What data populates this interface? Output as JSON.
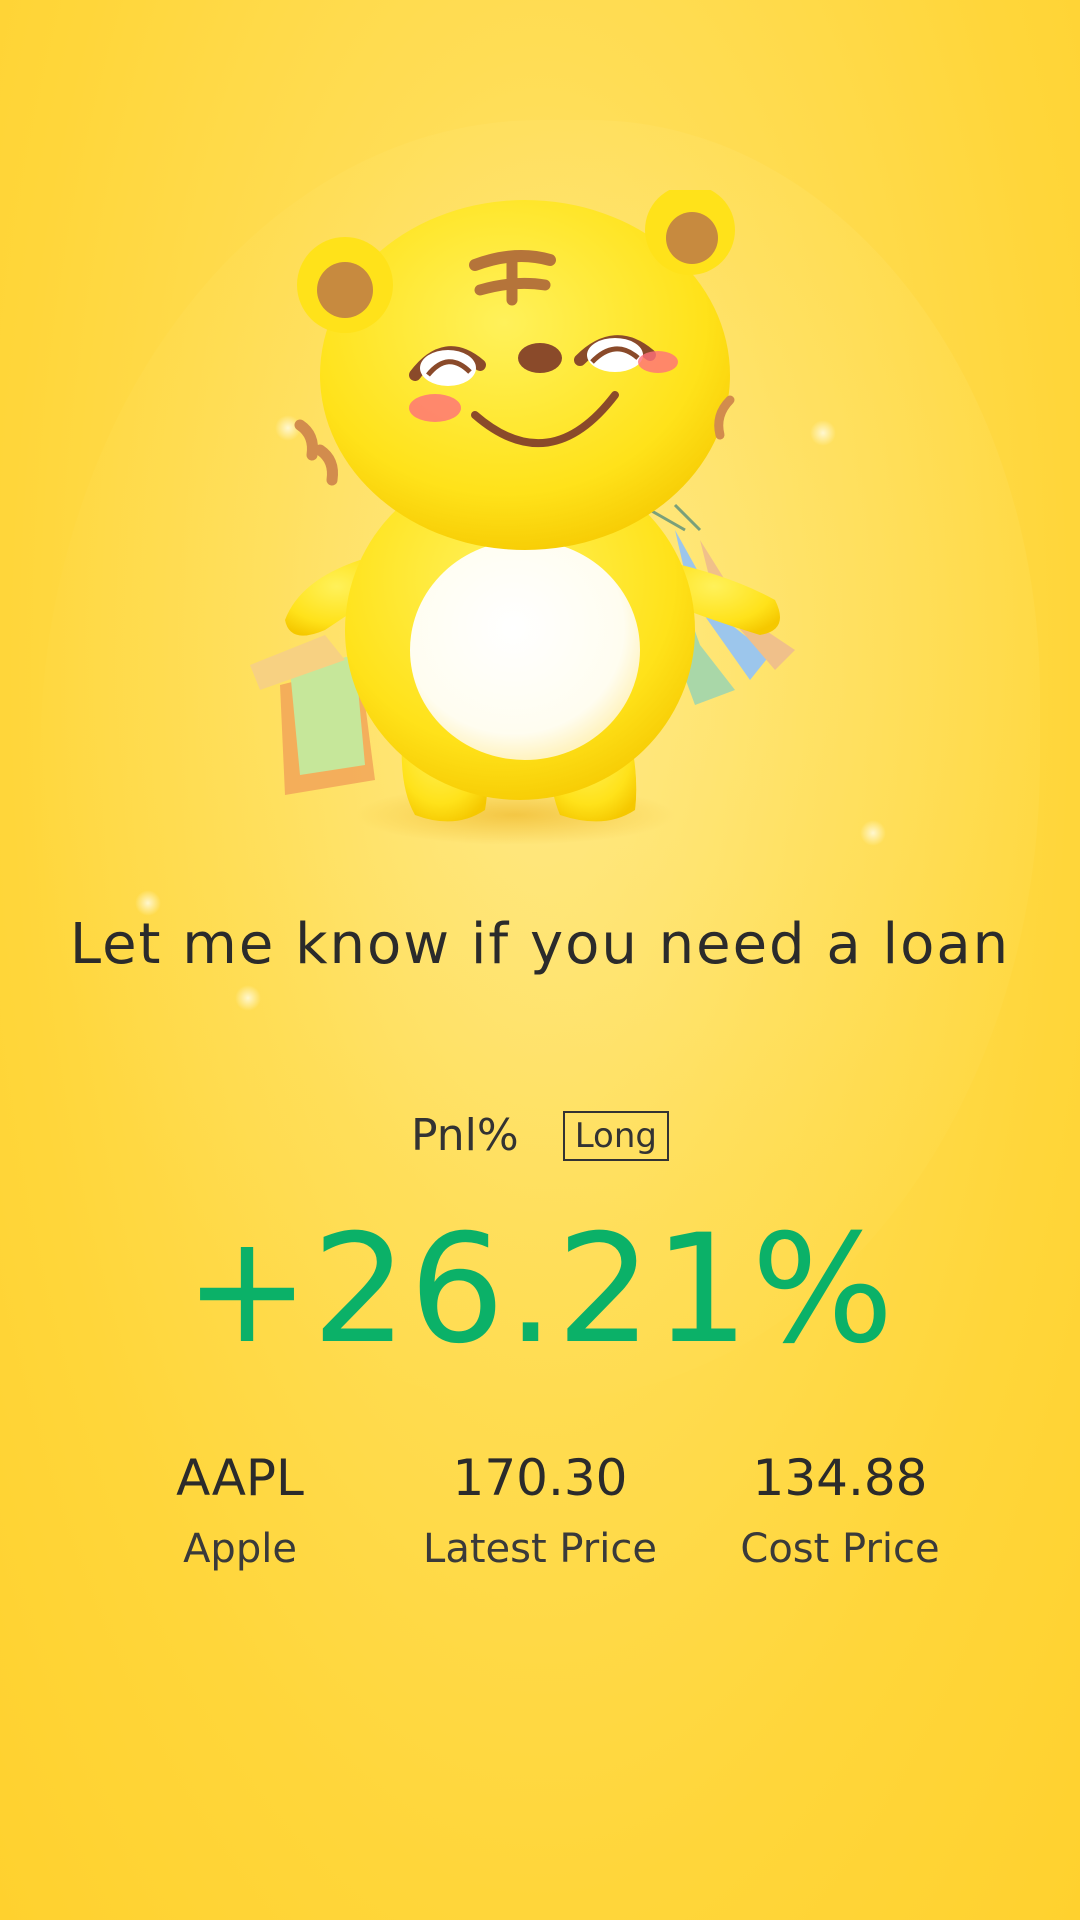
{
  "tagline": "Let me know if you need a loan",
  "pnl": {
    "label": "Pnl%",
    "direction_badge": "Long",
    "value": "+26.21%",
    "value_color": "#0bb168"
  },
  "stats": [
    {
      "value": "AAPL",
      "label": "Apple"
    },
    {
      "value": "170.30",
      "label": "Latest Price"
    },
    {
      "value": "134.88",
      "label": "Cost Price"
    }
  ],
  "mascot": {
    "icon": "tiger-mascot-icon",
    "accent_color": "#ffd63a"
  }
}
